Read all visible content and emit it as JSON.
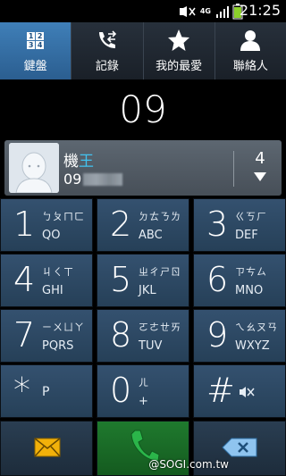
{
  "status": {
    "network": "4G",
    "time": "21:25"
  },
  "tabs": [
    {
      "label": "鍵盤",
      "icon": "keypad-grid-icon",
      "grid": [
        "1",
        "2",
        "3",
        "4"
      ]
    },
    {
      "label": "記錄",
      "icon": "call-log-icon"
    },
    {
      "label": "我的最愛",
      "icon": "star-icon"
    },
    {
      "label": "聯絡人",
      "icon": "contact-person-icon"
    }
  ],
  "dial": {
    "number": "09"
  },
  "contact": {
    "name_prefix": "機",
    "name_highlight": "王",
    "number_prefix": "09",
    "count": "4"
  },
  "keys": [
    {
      "digit": "1",
      "top": "ㄅㄆㄇㄈ",
      "bottom": "QO"
    },
    {
      "digit": "2",
      "top": "ㄉㄊㄋㄌ",
      "bottom": "ABC"
    },
    {
      "digit": "3",
      "top": "ㄍㄎㄏ",
      "bottom": "DEF"
    },
    {
      "digit": "4",
      "top": "ㄐㄑㄒ",
      "bottom": "GHI"
    },
    {
      "digit": "5",
      "top": "ㄓㄔㄕㄖ",
      "bottom": "JKL"
    },
    {
      "digit": "6",
      "top": "ㄗㄘㄙ",
      "bottom": "MNO"
    },
    {
      "digit": "7",
      "top": "ㄧㄨㄩㄚ",
      "bottom": "PQRS"
    },
    {
      "digit": "8",
      "top": "ㄛㄜㄝㄞ",
      "bottom": "TUV"
    },
    {
      "digit": "9",
      "top": "ㄟㄠㄡㄢ",
      "bottom": "WXYZ"
    },
    {
      "digit": "*",
      "top": "",
      "bottom": "P"
    },
    {
      "digit": "0",
      "top": "ㄦ",
      "bottom": "+"
    },
    {
      "digit": "#",
      "top": "",
      "bottom": ""
    }
  ],
  "bottom": {
    "message": "message-icon",
    "call": "call-icon",
    "delete": "backspace-icon"
  },
  "watermark": "@SOGI.com.tw",
  "colors": {
    "tab_active": "#3f7fb8",
    "key_bg": "#2e4a66",
    "highlight": "#42c3f0",
    "call_green": "#2bb54a",
    "message_yellow": "#f2b10a"
  }
}
